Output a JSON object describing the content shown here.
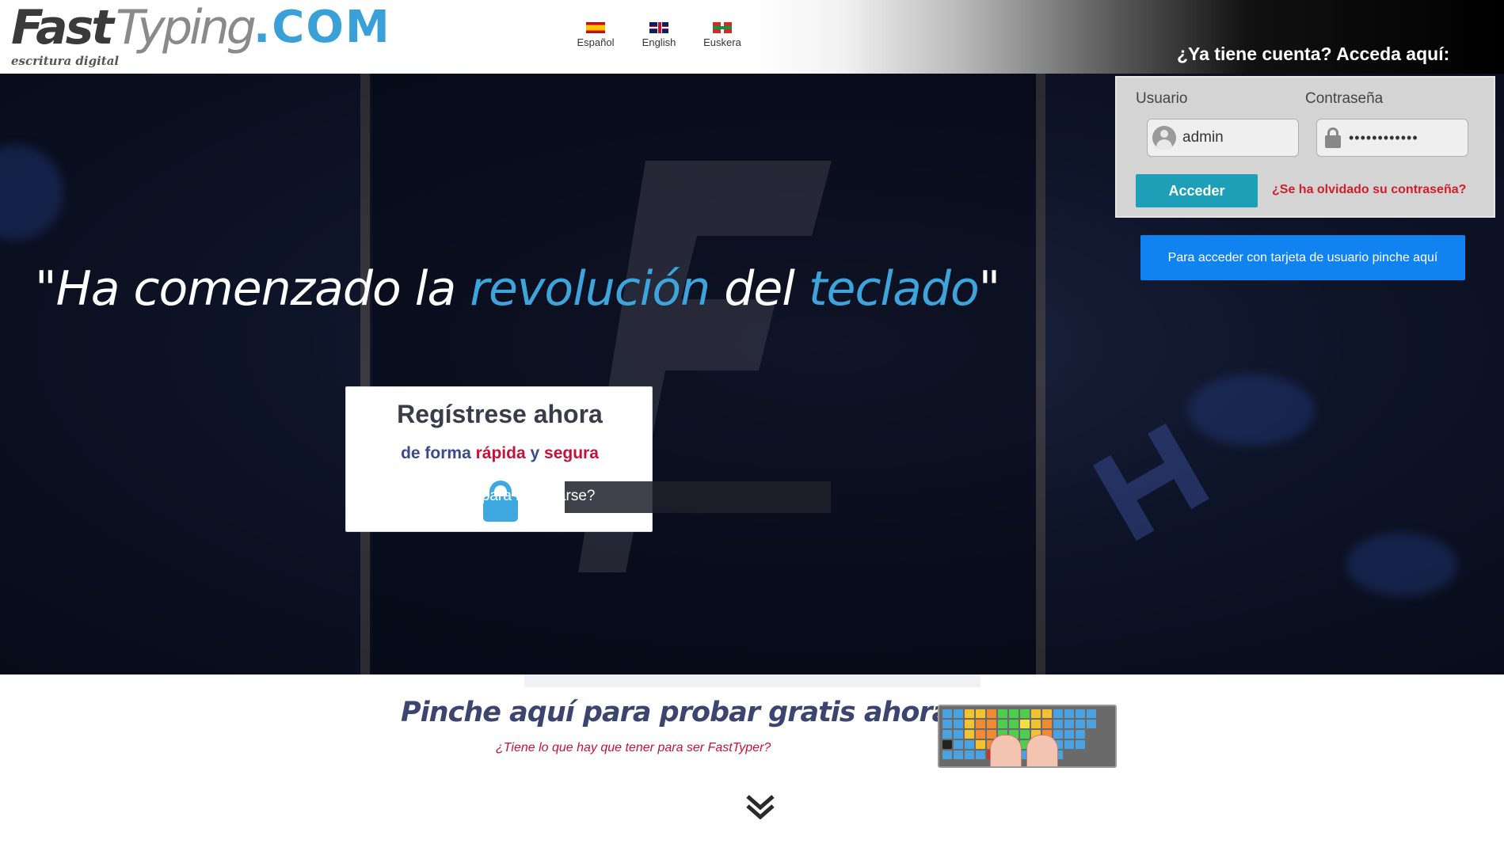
{
  "header": {
    "logo": {
      "fast": "Fast",
      "typing": "Typing",
      "domain": ".COM",
      "tagline": "escritura digital"
    },
    "languages": [
      {
        "label": "Español",
        "flag": "es-flag"
      },
      {
        "label": "English",
        "flag": "uk-flag"
      },
      {
        "label": "Euskera",
        "flag": "basque-flag"
      }
    ],
    "login_title": "¿Ya tiene cuenta? Acceda aquí:"
  },
  "login": {
    "user_label": "Usuario",
    "user_value": "admin",
    "password_label": "Contraseña",
    "password_value": "••••••••••••",
    "submit_label": "Acceder",
    "forgot_label": "¿Se ha olvidado su contraseña?",
    "card_button_label": "Para acceder con tarjeta de usuario pinche aquí"
  },
  "hero": {
    "quote_open": "\"Ha comenzado la ",
    "quote_accent1": "revolución",
    "quote_mid": " del ",
    "quote_accent2": "teclado",
    "quote_close": "\"",
    "register": {
      "title": "Regístrese ahora",
      "sub_1": "de forma ",
      "sub_2": "rápida",
      "sub_3": " y ",
      "sub_4": "segura"
    },
    "help_link": "¿Necesita ayuda para registrarse?"
  },
  "try_now": {
    "title": "Pinche aquí para probar gratis ahora:",
    "subtitle": "¿Tiene lo que hay que tener para ser FastTyper?"
  },
  "colors": {
    "accent_blue": "#3ea4dc",
    "button_teal": "#1e9fb8",
    "button_blue": "#1183f0",
    "alert_red": "#d01f2a",
    "title_navy": "#3c4470"
  }
}
